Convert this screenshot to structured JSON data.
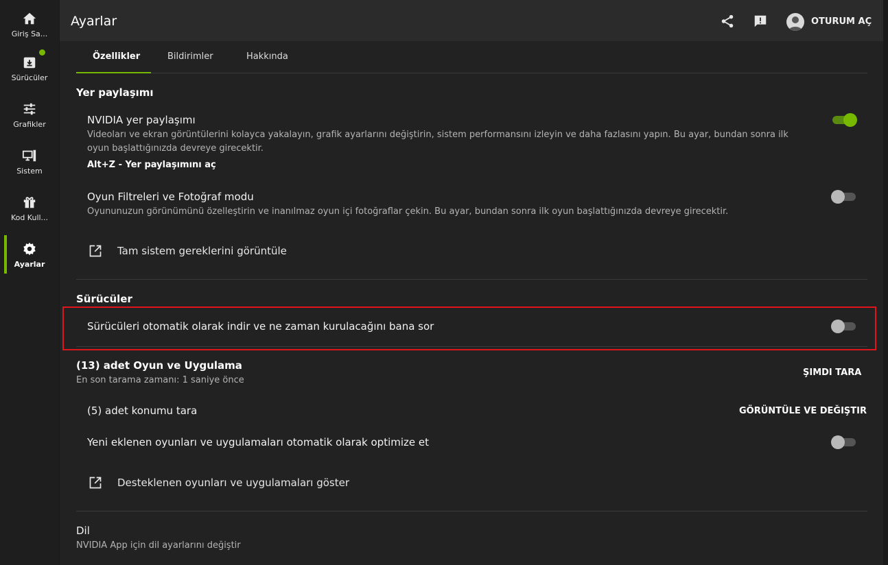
{
  "sidebar": {
    "items": [
      {
        "label": "Giriş Sa...",
        "icon": "home-icon"
      },
      {
        "label": "Sürücüler",
        "icon": "driver-download-icon"
      },
      {
        "label": "Grafikler",
        "icon": "sliders-icon"
      },
      {
        "label": "Sistem",
        "icon": "monitor-icon"
      },
      {
        "label": "Kod Kull...",
        "icon": "gift-icon"
      },
      {
        "label": "Ayarlar",
        "icon": "gear-icon"
      }
    ],
    "active": "Ayarlar",
    "notification_dot_on": "Sürücüler"
  },
  "header": {
    "title": "Ayarlar",
    "login_label": "OTURUM AÇ"
  },
  "tabs": [
    {
      "label": "Özellikler",
      "active": true
    },
    {
      "label": "Bildirimler",
      "active": false
    },
    {
      "label": "Hakkında",
      "active": false
    }
  ],
  "overlay": {
    "title": "Yer paylaşımı",
    "nvidia_overlay": {
      "title": "NVIDIA yer paylaşımı",
      "desc_line1": "Videoları ve ekran görüntülerini kolayca yakalayın, grafik ayarlarını değiştirin, sistem performansını izleyin ve daha fazlasını yapın. Bu ayar, bundan sonra ilk",
      "desc_line2": "oyun başlattığınızda devreye girecektir.",
      "shortcut": "Alt+Z - Yer paylaşımını aç",
      "enabled": true
    },
    "filters": {
      "title": "Oyun Filtreleri ve Fotoğraf modu",
      "desc": "Oyununuzun görünümünü özelleştirin ve inanılmaz oyun içi fotoğraflar çekin. Bu ayar, bundan sonra ilk oyun başlattığınızda devreye girecektir.",
      "enabled": false
    },
    "requirements_link": "Tam sistem gereklerini görüntüle"
  },
  "drivers": {
    "title": "Sürücüler",
    "auto_download": {
      "title": "Sürücüleri otomatik olarak indir ve ne zaman kurulacağını bana sor",
      "enabled": false
    }
  },
  "games": {
    "title": "(13) adet Oyun ve Uygulama",
    "last_scan": "En son tarama zamanı: 1 saniye önce",
    "scan_now": "ŞIMDI TARA",
    "locations": "(5) adet konumu tara",
    "view_change": "GÖRÜNTÜLE VE DEĞIŞTIR",
    "auto_optimize": {
      "title": "Yeni eklenen oyunları ve uygulamaları otomatik olarak optimize et",
      "enabled": false
    },
    "supported_link": "Desteklenen oyunları ve uygulamaları göster"
  },
  "language": {
    "title": "Dil",
    "desc": "NVIDIA App için dil ayarlarını değiştir"
  },
  "colors": {
    "accent": "#76b900",
    "highlight_border": "#e0151c",
    "background": "#222222",
    "topbar": "#2b2b2b"
  }
}
